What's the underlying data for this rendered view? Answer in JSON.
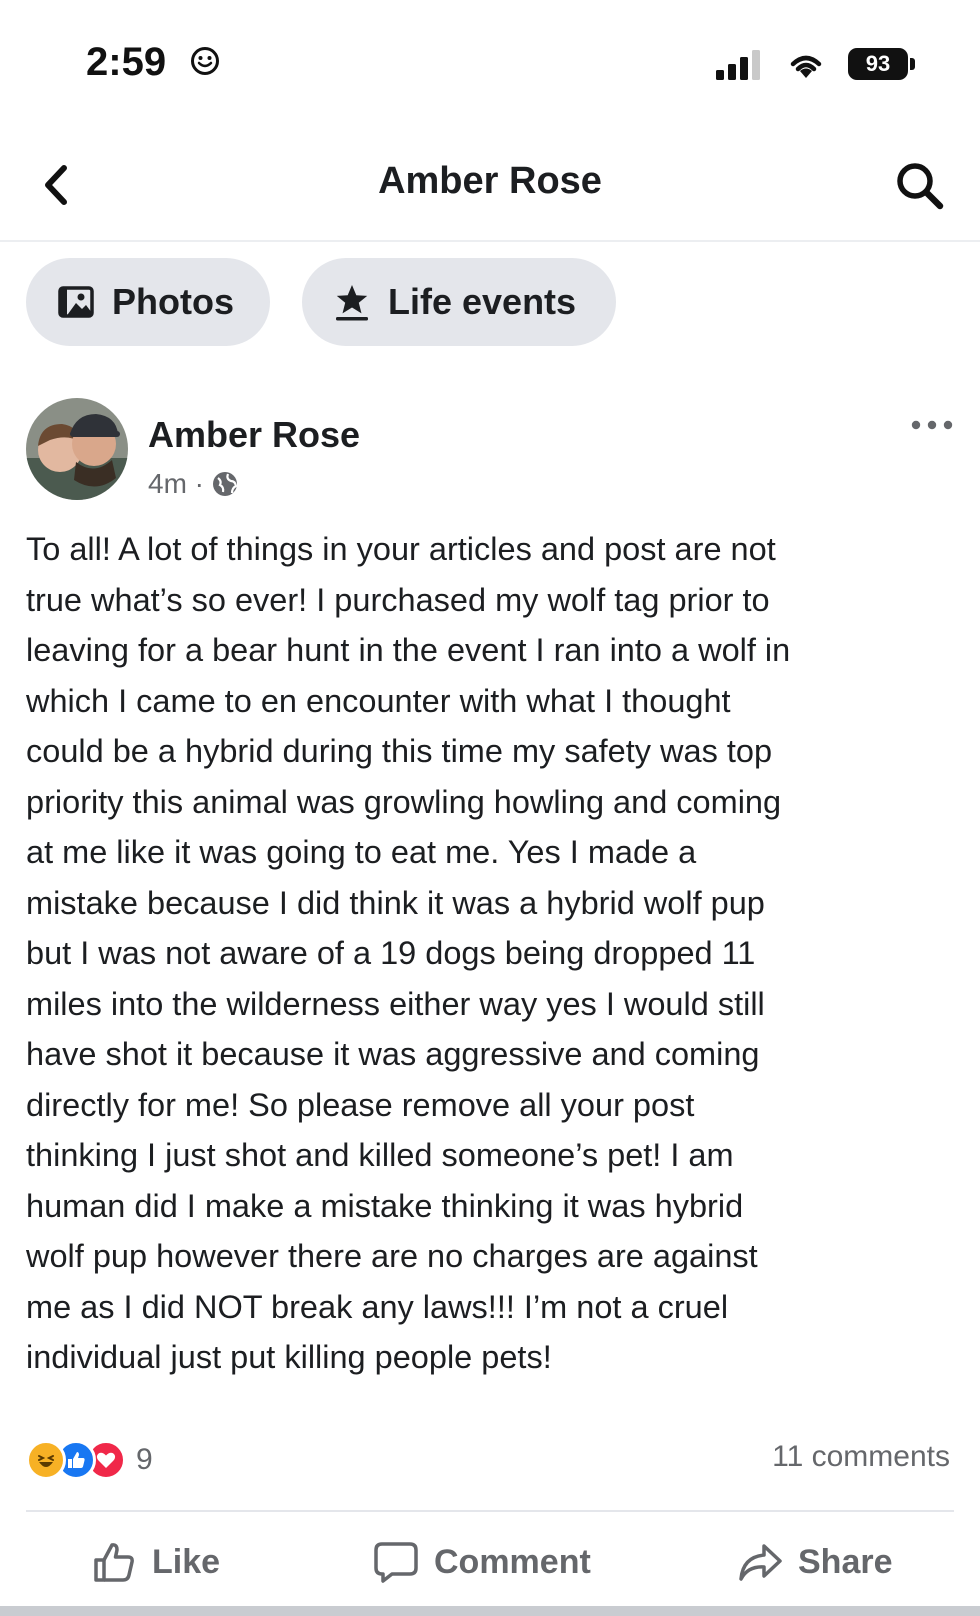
{
  "status_bar": {
    "time": "2:59",
    "battery": "93",
    "icons": [
      "smiley-icon",
      "signal-icon",
      "wifi-icon",
      "battery-icon"
    ]
  },
  "header": {
    "title": "Amber Rose",
    "icons": [
      "back-chevron-icon",
      "search-icon"
    ]
  },
  "tabs": [
    {
      "label": "Photos",
      "icon": "photos-icon"
    },
    {
      "label": "Life events",
      "icon": "star-flag-icon"
    }
  ],
  "post": {
    "author": "Amber Rose",
    "time_ago": "4m ·",
    "privacy_icon": "globe-icon",
    "text": "To all! A lot of things in your articles and post are not\ntrue what’s so ever! I purchased my wolf tag prior to\nleaving for a bear hunt in the event I ran into a wolf in\nwhich I came to en encounter with what I thought\ncould be a hybrid during this time my safety was top\npriority this animal was growling howling and coming\nat me like it was going to eat me. Yes I made a\nmistake because I did think it was a hybrid wolf pup\nbut I was not aware of a 19 dogs being dropped 11\nmiles into the wilderness either way yes I would still\nhave shot it  because it was aggressive and coming\ndirectly for me! So please remove all your post\nthinking I just shot and killed someone’s pet! I am\nhuman did I make a mistake thinking it was hybrid\nwolf pup however there are no charges are against\nme as I did NOT break any laws!!! I’m not a cruel\nindividual just put killing people pets!",
    "reaction_count": "9",
    "reaction_icons": [
      "haha-icon",
      "like-icon",
      "love-icon"
    ],
    "comments": "11 comments"
  },
  "actions": {
    "like": "Like",
    "comment": "Comment",
    "share": "Share"
  },
  "colors": {
    "text": "#1c1e21",
    "secondary": "#65676b",
    "chip": "#e4e6eb",
    "like_blue": "#1877f2",
    "love_red": "#f02849",
    "haha_yellow": "#f7b125"
  }
}
